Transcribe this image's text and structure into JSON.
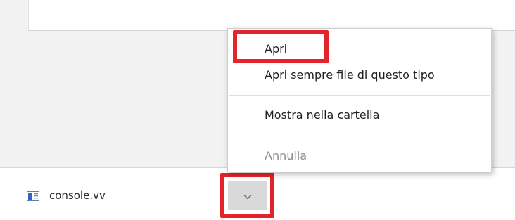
{
  "download_shelf": {
    "file_name": "console.vv",
    "file_icon": "document-icon"
  },
  "context_menu": {
    "items": [
      {
        "label": "Apri",
        "enabled": true
      },
      {
        "label": "Apri sempre file di questo tipo",
        "enabled": true
      },
      {
        "label": "Mostra nella cartella",
        "enabled": true
      },
      {
        "label": "Annulla",
        "enabled": false
      }
    ]
  },
  "dropdown_icon": "chevron-down-icon",
  "colors": {
    "highlight": "#e4242b",
    "menu_text": "#202020",
    "disabled_text": "#8c8c8c",
    "shelf_background": "#ffffff",
    "page_background": "#f2f2f2"
  }
}
